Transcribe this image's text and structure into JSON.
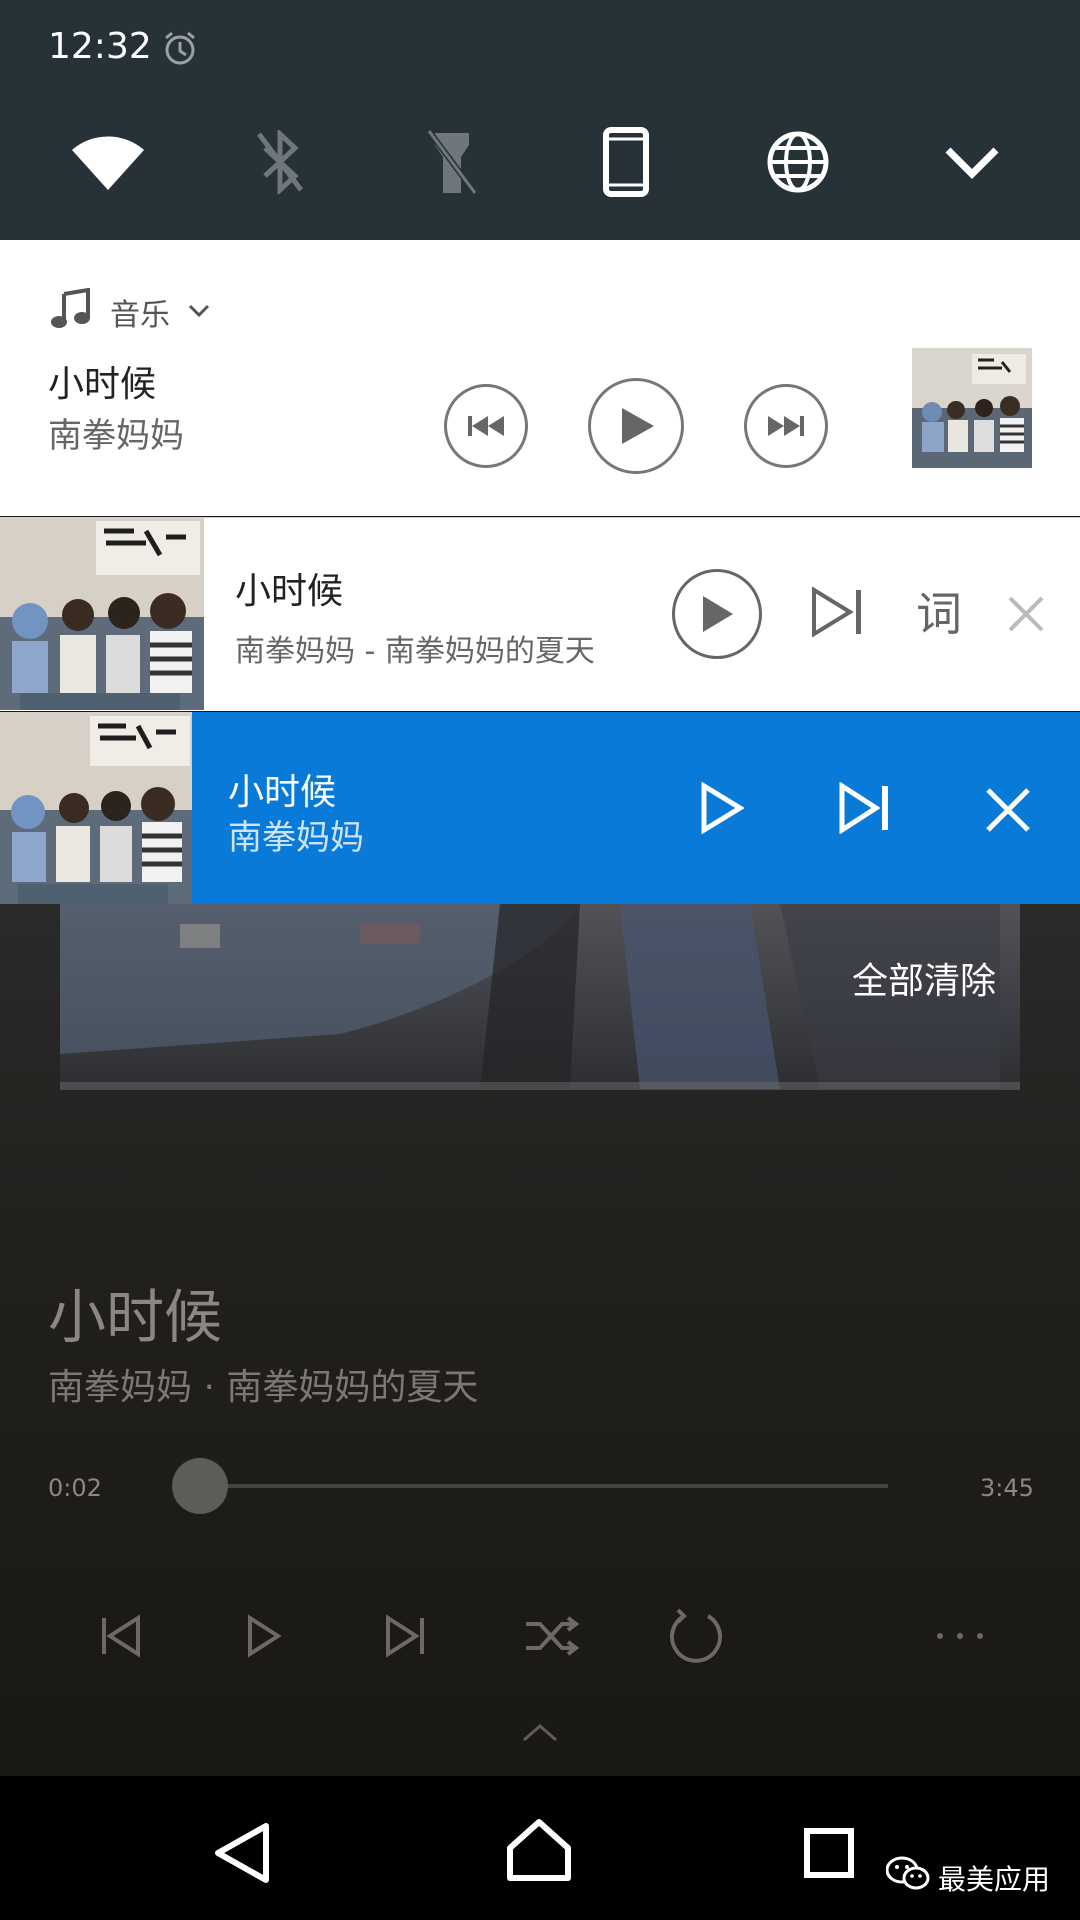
{
  "status_bar": {
    "time": "12:32"
  },
  "quick_settings": {
    "icons": [
      "wifi-icon",
      "bluetooth-off-icon",
      "flashlight-off-icon",
      "rotation-portrait-icon",
      "globe-icon",
      "chevron-down-icon"
    ]
  },
  "notif_system_media": {
    "app_label": "音乐",
    "title": "小时候",
    "artist": "南拳妈妈"
  },
  "notif_player_white": {
    "title": "小时候",
    "subtitle": "南拳妈妈 - 南拳妈妈的夏天",
    "lyrics_button": "词"
  },
  "notif_player_blue": {
    "title": "小时候",
    "artist": "南拳妈妈",
    "accent": "#0a7ad8"
  },
  "background_player": {
    "clear_all": "全部清除",
    "title": "小时候",
    "subtitle": "南拳妈妈 · 南拳妈妈的夏天",
    "time_current": "0:02",
    "time_total": "3:45",
    "progress_fraction": 0.009
  },
  "nav_bar": {
    "watermark": "最美应用"
  },
  "colors": {
    "qs_bg": "#263238",
    "nav_bg": "#000000"
  }
}
